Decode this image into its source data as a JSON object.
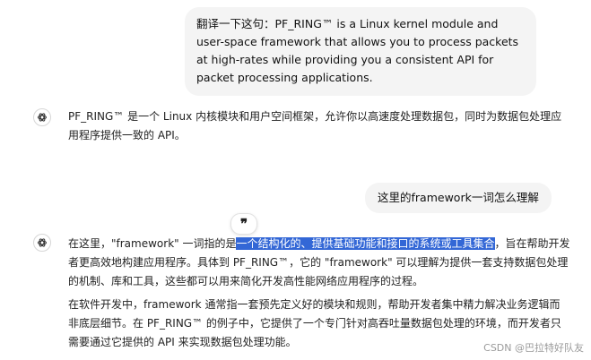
{
  "messages": {
    "user1": "翻译一下这句：PF_RING™ is a Linux kernel module and user-space framework that allows you to process packets at high-rates while providing you a consistent API for packet processing applications.",
    "assistant1": "PF_RING™ 是一个 Linux 内核模块和用户空间框架，允许你以高速度处理数据包，同时为数据包处理应用程序提供一致的 API。",
    "user2": "这里的framework一词怎么理解",
    "assistant2": {
      "p1_before": "在这里，\"framework\" 一词指的是",
      "p1_selected": "一个结构化的、提供基础功能和接口的系统或工具集合",
      "p1_after": "，旨在帮助开发者更高效地构建应用程序。具体到 PF_RING™，它的 \"framework\" 可以理解为提供一套支持数据包处理的机制、库和工具，这些都可以用来简化开发高性能网络应用程序的过程。",
      "p2": "在软件开发中，framework 通常指一套预先定义好的模块和规则，帮助开发者集中精力解决业务逻辑而非底层细节。在 PF_RING™ 的例子中，它提供了一个专门针对高吞吐量数据包处理的环境，而开发者只需要通过它提供的 API 来实现数据包处理功能。"
    }
  },
  "quote_button": "❞",
  "watermark": "CSDN @巴拉特好队友",
  "colors": {
    "selection": "#3367d6",
    "user_bubble": "#f4f4f4"
  },
  "icons": {
    "assistant_avatar": "openai-logo-icon",
    "quote": "quote-icon"
  }
}
